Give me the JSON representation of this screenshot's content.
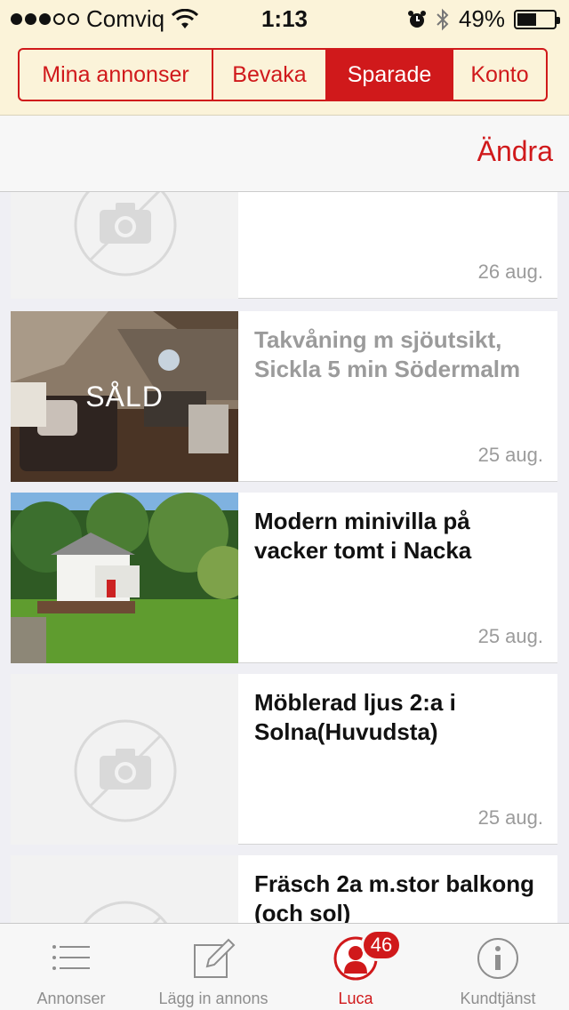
{
  "status_bar": {
    "carrier": "Comviq",
    "time": "1:13",
    "battery": "49%",
    "signal_strength": "3 of 5",
    "battery_level": 0.49
  },
  "segments": [
    {
      "label": "Mina annonser",
      "active": false
    },
    {
      "label": "Bevaka",
      "active": false
    },
    {
      "label": "Sparade",
      "active": true
    },
    {
      "label": "Konto",
      "active": false
    }
  ],
  "edit_label": "Ändra",
  "listings": [
    {
      "title": "",
      "date": "26 aug.",
      "image": "no-image-icon",
      "sold": false
    },
    {
      "title": "Takvåning m sjöutsikt, Sickla 5 min Södermalm",
      "date": "25 aug.",
      "image": "attic-apartment-photo",
      "sold": true,
      "sold_label": "SÅLD"
    },
    {
      "title": "Modern minivilla på vacker tomt i Nacka",
      "date": "25 aug.",
      "image": "white-villa-photo",
      "sold": false
    },
    {
      "title": "Möblerad ljus 2:a i Solna(Huvudsta)",
      "date": "25 aug.",
      "image": "no-image-icon",
      "sold": false
    },
    {
      "title": "Fräsch 2a m.stor balkong (och sol)",
      "date": "",
      "image": "no-image-icon",
      "sold": false
    }
  ],
  "tabs": [
    {
      "label": "Annonser",
      "icon": "list-icon",
      "active": false
    },
    {
      "label": "Lägg in annons",
      "icon": "compose-icon",
      "active": false
    },
    {
      "label": "Luca",
      "icon": "user-icon",
      "active": true,
      "badge": "46"
    },
    {
      "label": "Kundtjänst",
      "icon": "info-icon",
      "active": false
    }
  ],
  "colors": {
    "accent": "#d0191b",
    "header_bg": "#fbf3d9",
    "muted": "#9b9b9b"
  }
}
